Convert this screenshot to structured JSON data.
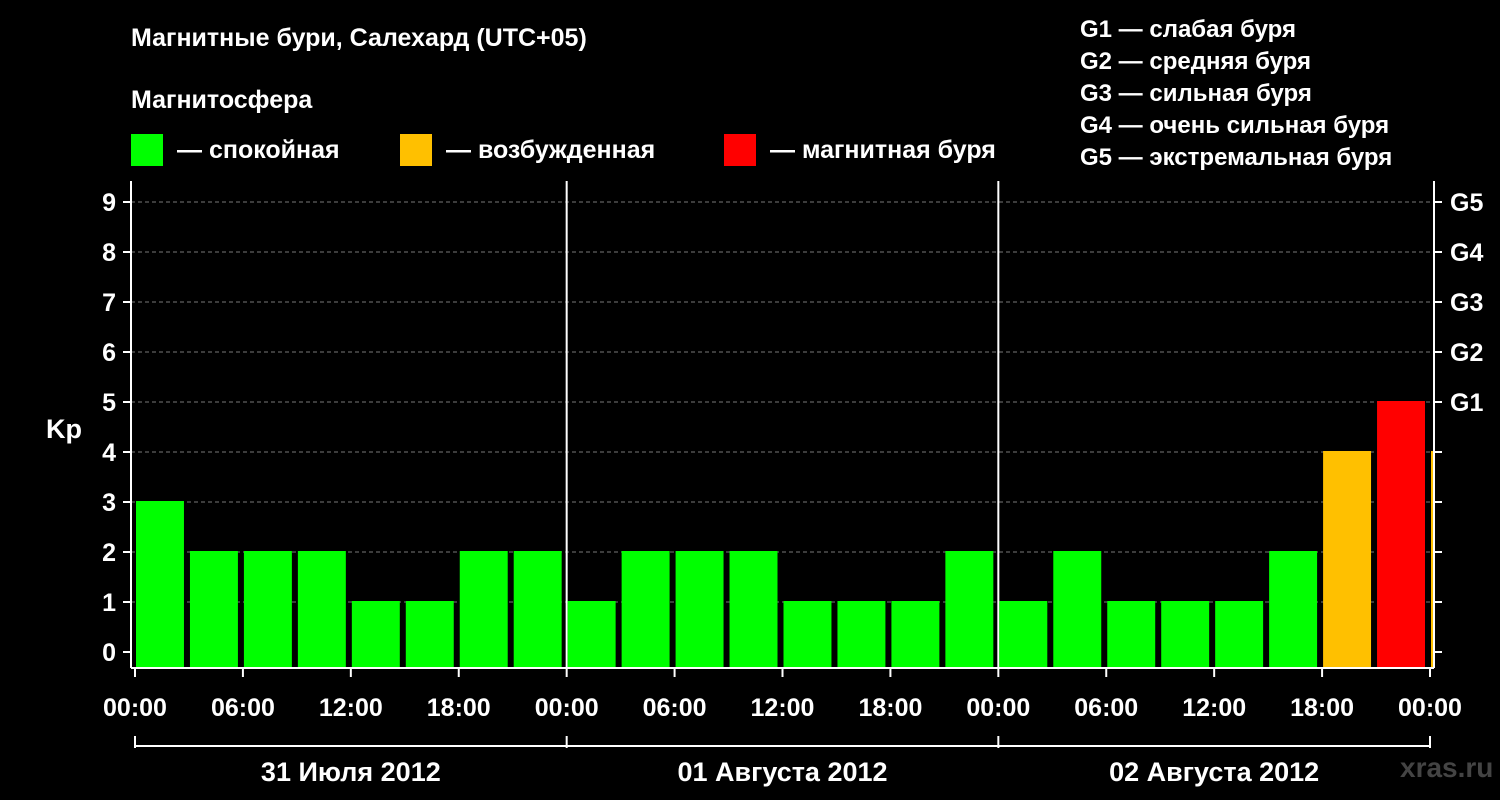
{
  "header": {
    "title": "Магнитные бури, Салехард (UTC+05)",
    "subtitle": "Магнитосфера"
  },
  "legend": [
    {
      "label": "— спокойная",
      "color": "#00ff00"
    },
    {
      "label": "— возбужденная",
      "color": "#ffc000"
    },
    {
      "label": "— магнитная буря",
      "color": "#ff0000"
    }
  ],
  "storm_scale": [
    "G1 — слабая буря",
    "G2 — средняя буря",
    "G3 — сильная буря",
    "G4 — очень сильная буря",
    "G5 — экстремальная буря"
  ],
  "watermark": "xras.ru",
  "chart_data": {
    "type": "bar",
    "ylabel": "Kp",
    "xlabel": "",
    "ylim": [
      0,
      9
    ],
    "yticks": [
      "0",
      "1",
      "2",
      "3",
      "4",
      "5",
      "6",
      "7",
      "8",
      "9"
    ],
    "right_ticks": [
      {
        "kp": 5,
        "label": "G1"
      },
      {
        "kp": 6,
        "label": "G2"
      },
      {
        "kp": 7,
        "label": "G3"
      },
      {
        "kp": 8,
        "label": "G4"
      },
      {
        "kp": 9,
        "label": "G5"
      }
    ],
    "grid": "dashed horizontal",
    "xticks": [
      "00:00",
      "06:00",
      "12:00",
      "18:00",
      "00:00",
      "06:00",
      "12:00",
      "18:00",
      "00:00",
      "06:00",
      "12:00",
      "18:00",
      "00:00"
    ],
    "days": [
      "31 Июля 2012",
      "01 Августа 2012",
      "02 Августа 2012"
    ],
    "interval_hours": 3,
    "values": [
      3,
      2,
      2,
      2,
      1,
      1,
      2,
      2,
      1,
      2,
      2,
      2,
      1,
      1,
      1,
      2,
      1,
      2,
      1,
      1,
      1,
      2,
      4,
      5,
      4
    ],
    "colors": [
      "#00ff00",
      "#00ff00",
      "#00ff00",
      "#00ff00",
      "#00ff00",
      "#00ff00",
      "#00ff00",
      "#00ff00",
      "#00ff00",
      "#00ff00",
      "#00ff00",
      "#00ff00",
      "#00ff00",
      "#00ff00",
      "#00ff00",
      "#00ff00",
      "#00ff00",
      "#00ff00",
      "#00ff00",
      "#00ff00",
      "#00ff00",
      "#00ff00",
      "#ffc000",
      "#ff0000",
      "#ffc000"
    ]
  }
}
